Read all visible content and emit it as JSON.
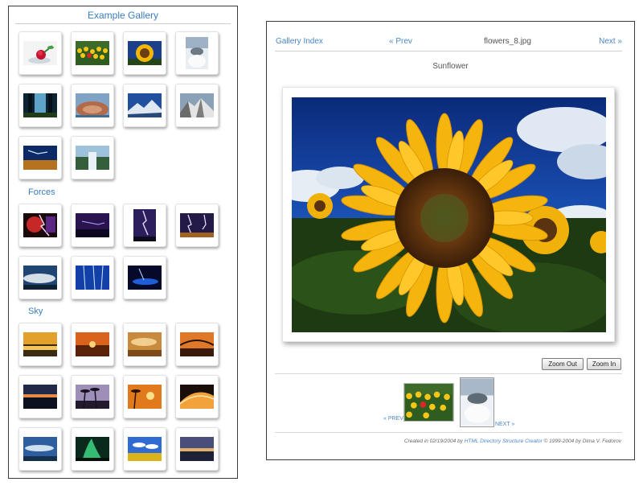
{
  "gallery": {
    "title": "Example Gallery",
    "sections": [
      {
        "label": "",
        "thumbs": [
          "rose",
          "tulips",
          "sunflower",
          "flower-white",
          "forest-path",
          "town-aerial",
          "snow-mountain",
          "rocky-mountain",
          "lightning-field",
          "waterfall"
        ]
      },
      {
        "label": "Forces",
        "thumbs": [
          "fire-lightning",
          "purple-storm",
          "lightning-tower",
          "lightning-city",
          "storm-clouds",
          "blue-lightning",
          "night-storm"
        ]
      },
      {
        "label": "Sky",
        "thumbs": [
          "sunset-lake",
          "sunset-orange",
          "sunset-clouds",
          "bridge-sunset",
          "dusk-horizon",
          "palm-sunset",
          "tropical-sunset",
          "wave-sunset",
          "blue-sky",
          "aurora",
          "field-sky",
          "twilight-sea"
        ]
      }
    ]
  },
  "viewer": {
    "nav": {
      "index_label": "Gallery Index",
      "prev_label": "« Prev",
      "file_name": "flowers_8.jpg",
      "next_label": "Next »"
    },
    "caption": "Sunflower",
    "zoom_out_label": "Zoom Out",
    "zoom_in_label": "Zoom In",
    "filmstrip": {
      "prev_label": "« PREV",
      "next_label": "NEXT »"
    },
    "footer": {
      "prefix": "Created in 02/19/2004 by ",
      "link": "HTML Directory Structure Creator",
      "suffix": " © 1999-2004 by Dima V. Fedorov"
    }
  },
  "colors": {
    "link": "#4a86c5",
    "section": "#3a7dbd",
    "border": "#3a3a3a"
  }
}
